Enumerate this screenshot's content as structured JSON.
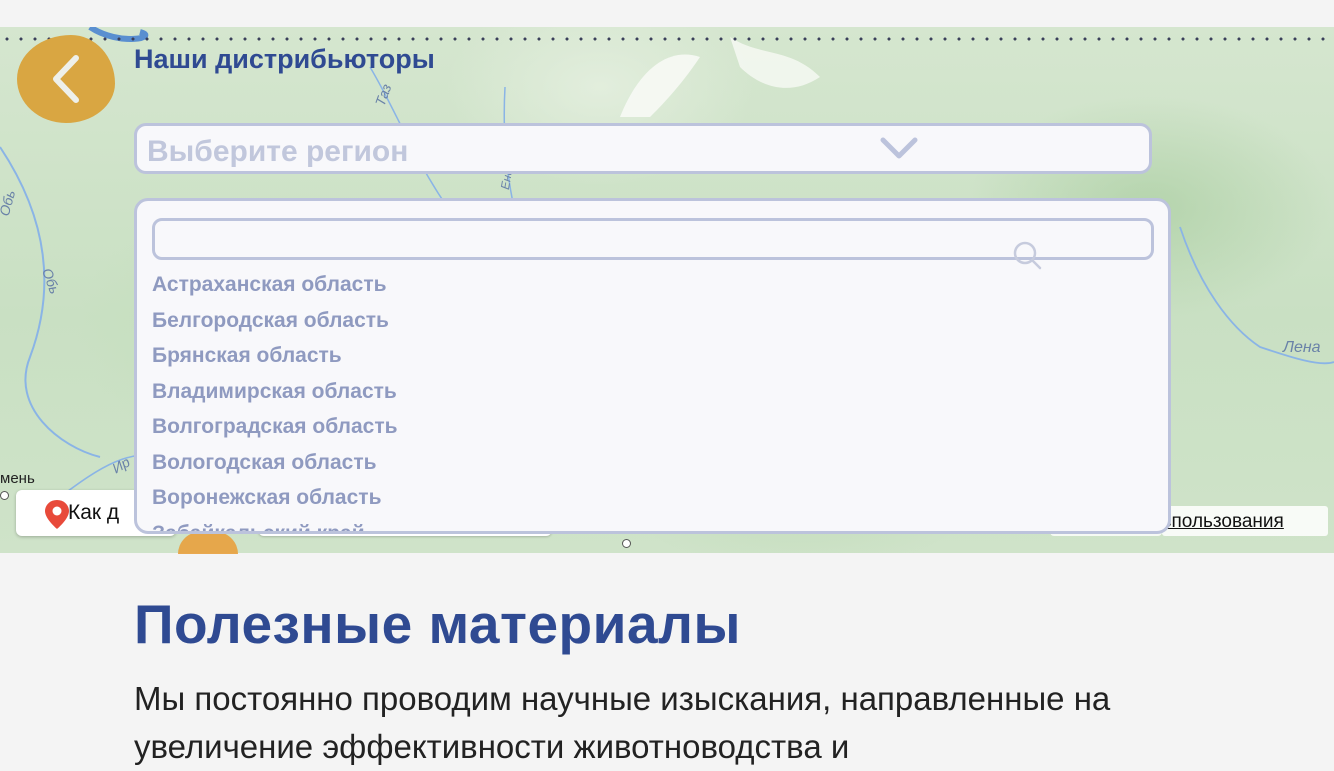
{
  "map": {
    "labels": {
      "taz": "Таз",
      "ob_top": "Обь",
      "ob_mid": "Обь",
      "lena": "Лена",
      "irtysh": "Ир",
      "enisei": "Ени"
    },
    "city_fragment": "мень",
    "route_button": "Как д",
    "terms_link": "спользования"
  },
  "header": {
    "back_icon": "chevron-left-icon",
    "title": "Наши дистрибьюторы"
  },
  "region_select": {
    "placeholder": "Выберите регион",
    "icon": "chevron-down-icon"
  },
  "dropdown": {
    "search_placeholder": "",
    "search_icon": "search-icon",
    "items": [
      {
        "label": "Астраханская область"
      },
      {
        "label": "Белгородская область"
      },
      {
        "label": "Брянская область"
      },
      {
        "label": "Владимирская область"
      },
      {
        "label": "Волгоградская область"
      },
      {
        "label": "Вологодская область"
      },
      {
        "label": "Воронежская область"
      },
      {
        "label": "Забайкальский край"
      }
    ]
  },
  "materials": {
    "title": "Полезные материалы",
    "text": "Мы постоянно проводим научные изыскания, направленные на увеличение эффективности животноводства и"
  },
  "colors": {
    "accent_blue": "#2f4a92",
    "back_orange": "#d9a642",
    "border": "#bcc3dc",
    "list_text": "#8f9ac0"
  }
}
